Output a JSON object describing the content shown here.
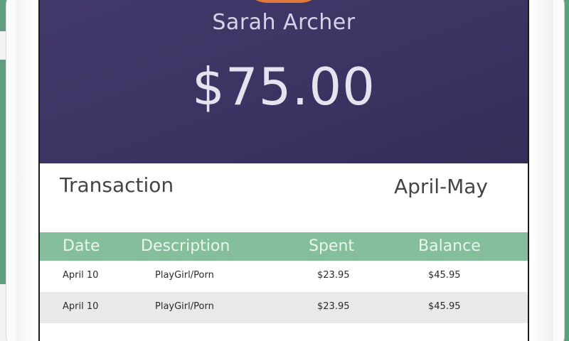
{
  "profile": {
    "name": "Sarah Archer",
    "balance": "$75.00"
  },
  "transactions": {
    "title": "Transaction",
    "period": "April-May",
    "headers": {
      "date": "Date",
      "description": "Description",
      "spent": "Spent",
      "balance": "Balance"
    },
    "rows": [
      {
        "date": "April 10",
        "description": "PlayGirl/Porn",
        "spent": "$23.95",
        "balance": "$45.95"
      },
      {
        "date": "April 10",
        "description": "PlayGirl/Porn",
        "spent": "$23.95",
        "balance": "$45.95"
      }
    ]
  },
  "colors": {
    "hero": "#3b3361",
    "table_header": "#84be9b",
    "avatar": "#e07a3c",
    "background": "#5f9f80"
  }
}
